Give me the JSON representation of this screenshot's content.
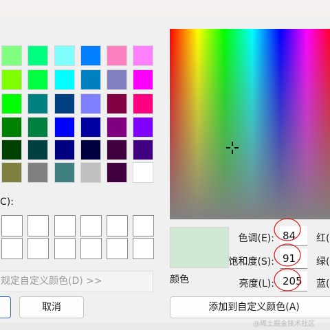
{
  "basic_colors": [
    [
      "#80ff80",
      "#00ff80",
      "#80ffff",
      "#0080ff",
      "#ff80c0",
      "#ff80ff"
    ],
    [
      "#80ff00",
      "#00ff40",
      "#00ffff",
      "#0080c0",
      "#8080c0",
      "#ff00ff"
    ],
    [
      "#00ff00",
      "#008080",
      "#004080",
      "#8080ff",
      "#800040",
      "#ff0080"
    ],
    [
      "#008000",
      "#008040",
      "#0000ff",
      "#0000a0",
      "#800080",
      "#8000ff"
    ],
    [
      "#004000",
      "#004040",
      "#000080",
      "#000040",
      "#400040",
      "#400080"
    ],
    [
      "#808040",
      "#808080",
      "#408080",
      "#c0c0c0",
      "#400040",
      "#ffffff"
    ]
  ],
  "custom_colors_label": "C):",
  "define_custom_label": "规定自定义颜色(D) >>",
  "ok_label": "",
  "cancel_label": "取消",
  "add_custom_label": "添加到自定义颜色(A)",
  "color_label": "颜色",
  "selected_color": "#cfe8d4",
  "fields": {
    "hue": {
      "label": "色调(E):",
      "value": "84"
    },
    "sat": {
      "label": "饱和度(S):",
      "value": "91"
    },
    "lum": {
      "label": "亮度(L):",
      "value": "205"
    }
  },
  "rgb_labels": {
    "red": "红(",
    "green": "绿(",
    "blue": "蓝("
  },
  "watermark": "@稀土掘金技术社区"
}
